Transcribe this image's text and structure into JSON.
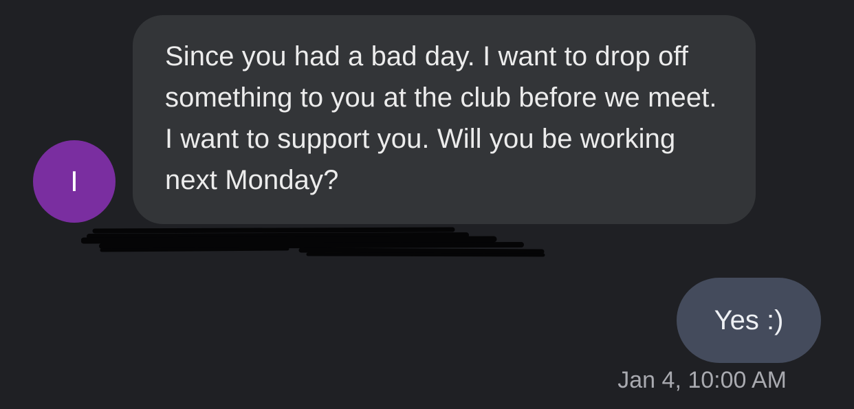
{
  "conversation": {
    "incoming": {
      "avatar_initial": "I",
      "message": "Since you had a bad day. I want to drop off something to you at the club before we meet. I want to support you. Will you be working next Monday?"
    },
    "outgoing": {
      "message": "Yes :)",
      "timestamp": "Jan 4, 10:00 AM"
    }
  },
  "colors": {
    "background": "#1f2024",
    "incoming_bubble": "#333538",
    "outgoing_bubble": "#444b5c",
    "avatar": "#7a2ea0",
    "timestamp_text": "#a9aab0"
  }
}
